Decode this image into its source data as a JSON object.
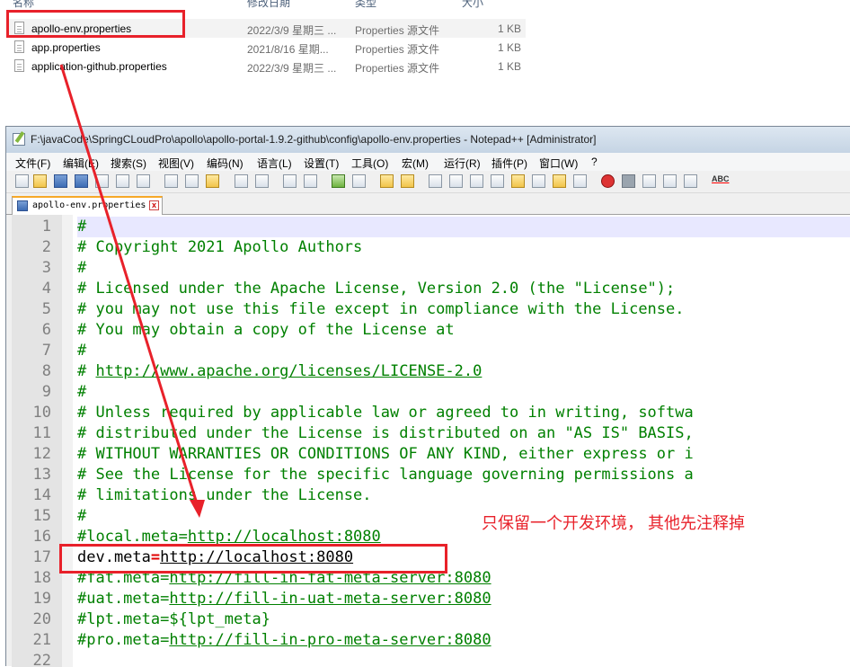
{
  "explorer": {
    "headers": [
      "名称",
      "修改日期",
      "类型",
      "大小"
    ],
    "files": [
      {
        "name": "apollo-env.properties",
        "date": "2022/3/9 星期三 ...",
        "type": "Properties 源文件",
        "size": "1 KB",
        "selected": true
      },
      {
        "name": "app.properties",
        "date": "2021/8/16 星期...",
        "type": "Properties 源文件",
        "size": "1 KB",
        "selected": false
      },
      {
        "name": "application-github.properties",
        "date": "2022/3/9 星期三 ...",
        "type": "Properties 源文件",
        "size": "1 KB",
        "selected": false
      }
    ]
  },
  "window": {
    "title": "F:\\javaCode\\SpringCLoudPro\\apollo\\apollo-portal-1.9.2-github\\config\\apollo-env.properties - Notepad++ [Administrator]"
  },
  "menu": [
    "文件(F)",
    "编辑(E)",
    "搜索(S)",
    "视图(V)",
    "编码(N)",
    "语言(L)",
    "设置(T)",
    "工具(O)",
    "宏(M)",
    "运行(R)",
    "插件(P)",
    "窗口(W)",
    "?"
  ],
  "toolbar": {
    "spellcheck_label": "ABC"
  },
  "tab": {
    "label": "apollo-env.properties",
    "close": "x"
  },
  "editor": {
    "lines": [
      {
        "n": "1",
        "t": "#"
      },
      {
        "n": "2",
        "t": "# Copyright 2021 Apollo Authors"
      },
      {
        "n": "3",
        "t": "#"
      },
      {
        "n": "4",
        "t": "# Licensed under the Apache License, Version 2.0 (the \"License\");"
      },
      {
        "n": "5",
        "t": "# you may not use this file except in compliance with the License."
      },
      {
        "n": "6",
        "t": "# You may obtain a copy of the License at"
      },
      {
        "n": "7",
        "t": "#"
      },
      {
        "n": "8",
        "t": "# http://www.apache.org/licenses/LICENSE-2.0"
      },
      {
        "n": "9",
        "t": "#"
      },
      {
        "n": "10",
        "t": "# Unless required by applicable law or agreed to in writing, softwa"
      },
      {
        "n": "11",
        "t": "# distributed under the License is distributed on an \"AS IS\" BASIS,"
      },
      {
        "n": "12",
        "t": "# WITHOUT WARRANTIES OR CONDITIONS OF ANY KIND, either express or i"
      },
      {
        "n": "13",
        "t": "# See the License for the specific language governing permissions a"
      },
      {
        "n": "14",
        "t": "# limitations under the License."
      },
      {
        "n": "15",
        "t": "#"
      },
      {
        "n": "16",
        "t": "#local.meta=http://localhost:8080"
      },
      {
        "n": "17",
        "t": "dev.meta=http://localhost:8080"
      },
      {
        "n": "18",
        "t": "#fat.meta=http://fill-in-fat-meta-server:8080"
      },
      {
        "n": "19",
        "t": "#uat.meta=http://fill-in-uat-meta-server:8080"
      },
      {
        "n": "20",
        "t": "#lpt.meta=${lpt_meta}"
      },
      {
        "n": "21",
        "t": "#pro.meta=http://fill-in-pro-meta-server:8080"
      },
      {
        "n": "22",
        "t": ""
      }
    ]
  },
  "annotation": {
    "note": "只保留一个开发环境， 其他先注释掉",
    "color": "#e8212a"
  }
}
